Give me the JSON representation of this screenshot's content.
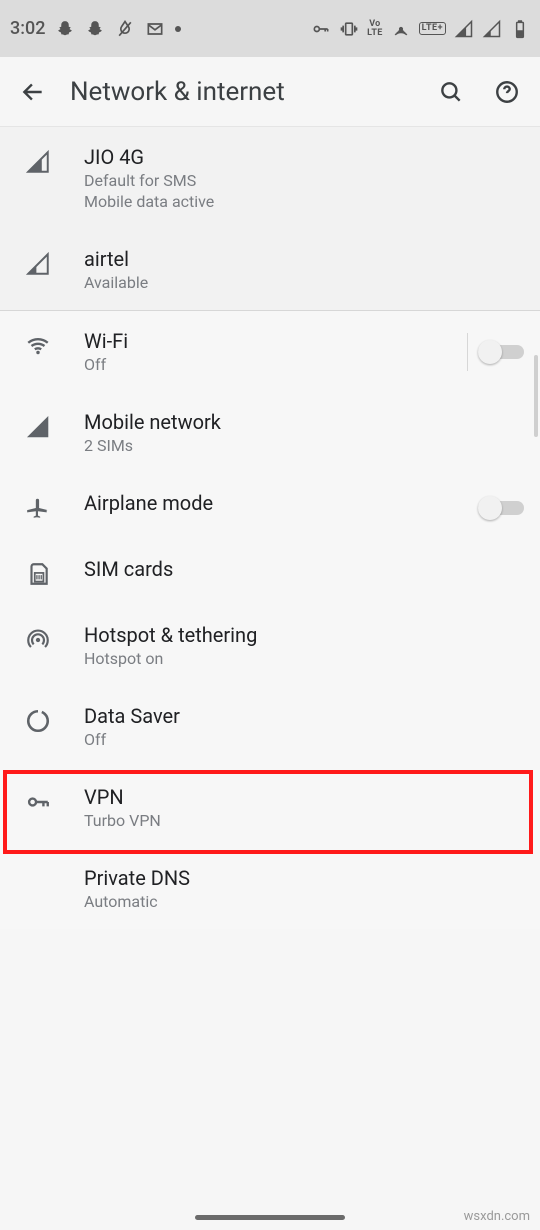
{
  "status": {
    "time": "3:02",
    "lte": "LTE+",
    "volte": "VoLTE"
  },
  "appbar": {
    "title": "Network & internet"
  },
  "sims": [
    {
      "title": "JIO 4G",
      "sub1": "Default for SMS",
      "sub2": "Mobile data active"
    },
    {
      "title": "airtel",
      "sub1": "Available"
    }
  ],
  "rows": {
    "wifi": {
      "title": "Wi-Fi",
      "sub": "Off"
    },
    "mobile": {
      "title": "Mobile network",
      "sub": "2 SIMs"
    },
    "airplane": {
      "title": "Airplane mode"
    },
    "sim": {
      "title": "SIM cards"
    },
    "hotspot": {
      "title": "Hotspot & tethering",
      "sub": "Hotspot on"
    },
    "datasaver": {
      "title": "Data Saver",
      "sub": "Off"
    },
    "vpn": {
      "title": "VPN",
      "sub": "Turbo VPN"
    },
    "pdns": {
      "title": "Private DNS",
      "sub": "Automatic"
    }
  },
  "watermark": "wsxdn.com"
}
